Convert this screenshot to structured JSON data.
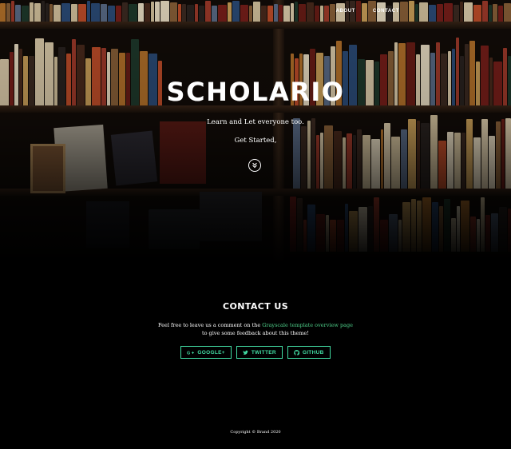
{
  "nav": {
    "items": [
      {
        "label": "About"
      },
      {
        "label": "Contact"
      }
    ]
  },
  "hero": {
    "brand": "SCHOLARIO",
    "tagline": "Learn and Let everyone too.",
    "cta": "Get Started,",
    "scroll_icon": "chevron-double-down-icon"
  },
  "contact": {
    "title": "CONTACT US",
    "text_before": "Feel free to leave us a comment on the ",
    "link_text": "Grayscale template overview page",
    "text_after": " to give some feedback about this theme!",
    "buttons": [
      {
        "label": "Google+",
        "icon": "google-plus-icon"
      },
      {
        "label": "Twitter",
        "icon": "twitter-icon"
      },
      {
        "label": "Github",
        "icon": "github-icon"
      }
    ]
  },
  "footer": {
    "copyright": "Copyright © Brand 2020"
  },
  "colors": {
    "accent": "#42dca3",
    "link": "#4fd28b",
    "background": "#000000"
  }
}
